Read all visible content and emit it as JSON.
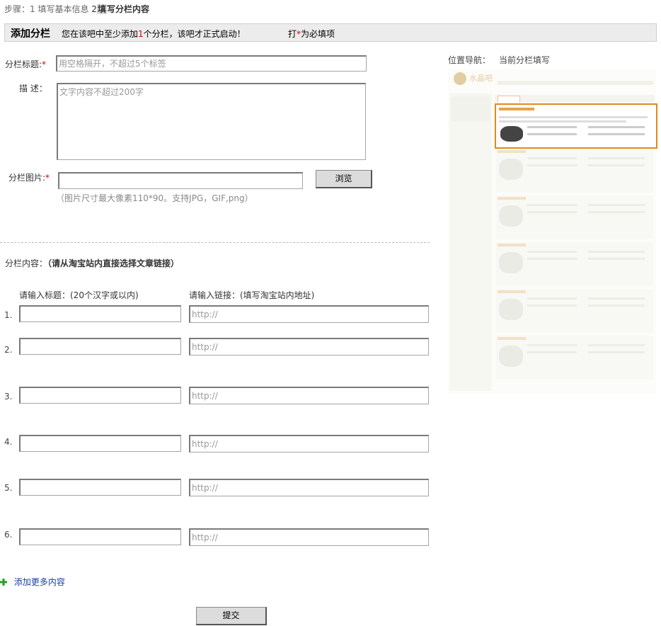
{
  "steps": {
    "prefix": "步骤：",
    "step1": "1 填写基本信息",
    "step2_num": "2",
    "step2_hl": "填",
    "step2_rest": "写分栏内容"
  },
  "header": {
    "title": "添加分栏",
    "msg_before": "您在该吧中至少添加",
    "msg_count": "1",
    "msg_after": "个分栏，该吧才正式启动！",
    "req_before": "打",
    "req_star": "*",
    "req_after": "为必填项"
  },
  "form": {
    "title_label": "分栏标题:",
    "title_placeholder": "用空格隔开，不超过5个标签",
    "desc_label": "描  述：",
    "desc_placeholder": "文字内容不超过200字",
    "image_label": "分栏图片:",
    "browse_label": "浏览",
    "image_hint": "（图片尺寸最大像素110*90。支持JPG，GIF,png）",
    "star": "*"
  },
  "content": {
    "section_label": "分栏内容：",
    "section_note": "（请从淘宝站内直接选择文章链接）",
    "col_title": "请输入标题：(20个汉字或以内)",
    "col_link": "请输入链接：(填写淘宝站内地址)",
    "link_placeholder": "http://",
    "rows": [
      {
        "num": "1."
      },
      {
        "num": "2."
      },
      {
        "num": "3."
      },
      {
        "num": "4."
      },
      {
        "num": "5."
      },
      {
        "num": "6."
      }
    ],
    "add_more": "添加更多内容",
    "submit": "提交"
  },
  "preview": {
    "nav_label": "位置导航：",
    "nav_value": "当前分栏填写",
    "logo_text": "水晶吧"
  },
  "colors": {
    "required": "#dd0000",
    "highlight_border": "#e08a1a",
    "add_icon": "#2a9d2a",
    "link": "#1a3fa0"
  }
}
